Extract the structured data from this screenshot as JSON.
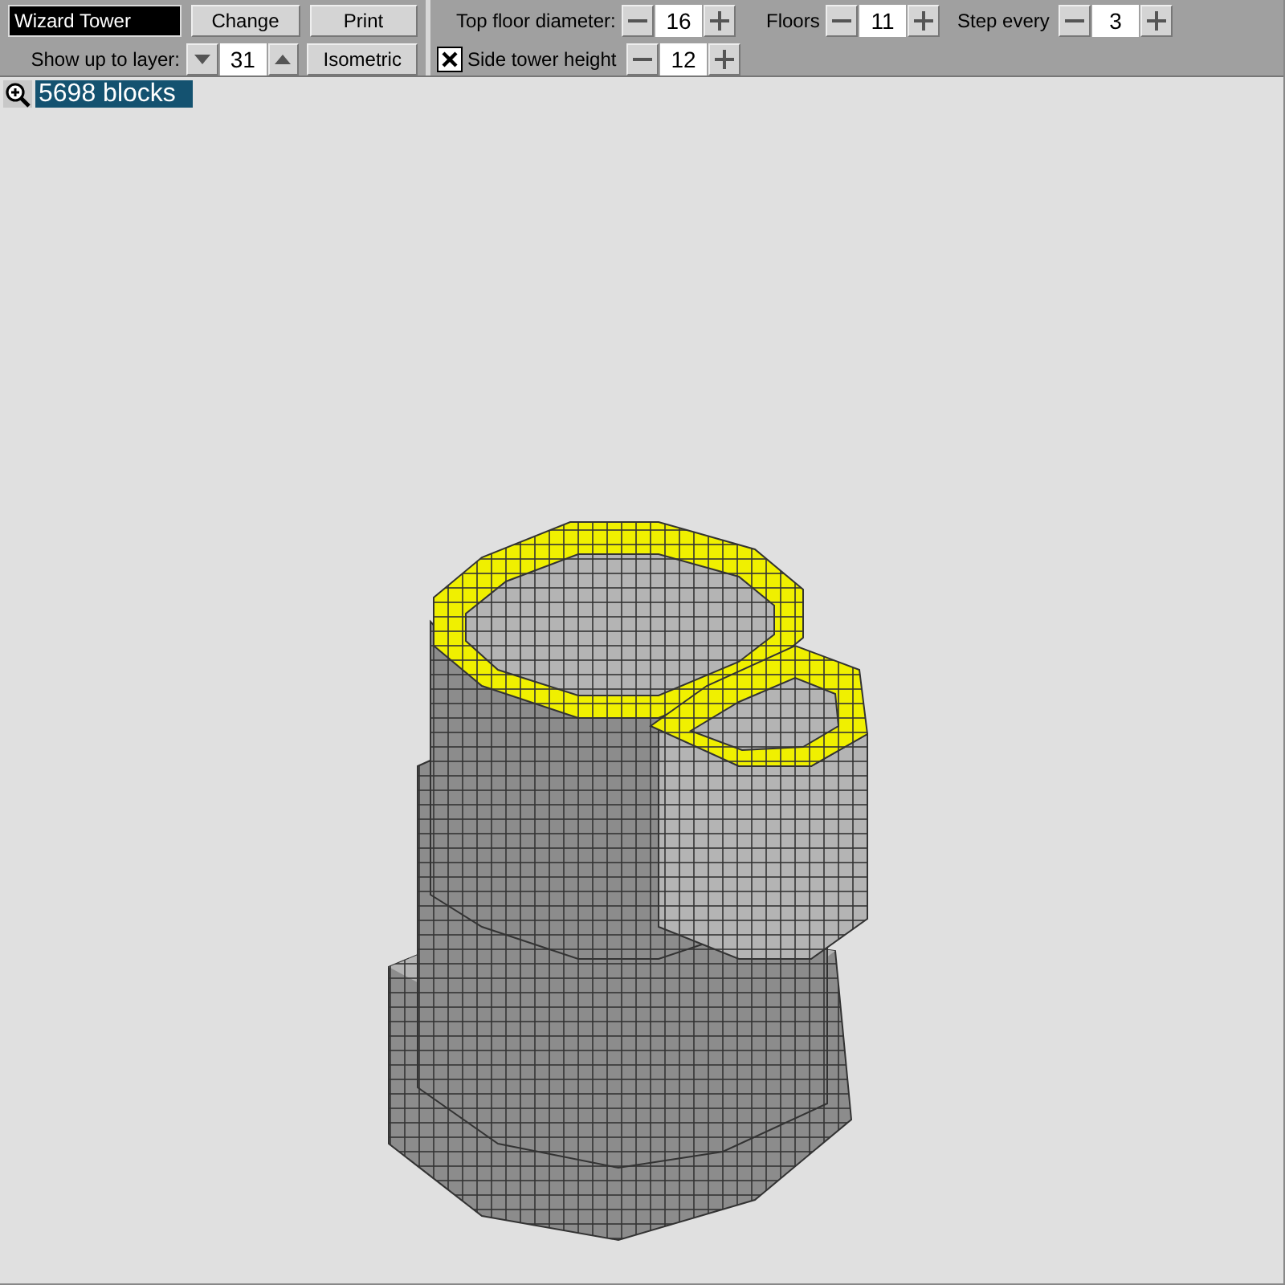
{
  "name_field": {
    "value": "Wizard Tower"
  },
  "buttons": [
    {
      "label": "Change"
    },
    {
      "label": "Print"
    },
    {
      "label": "Isometric"
    }
  ],
  "layer": {
    "label": "Show up to layer:",
    "value": "31"
  },
  "top_floor_diameter": {
    "label": "Top floor diameter:",
    "value": "16"
  },
  "floors": {
    "label": "Floors",
    "value": "11"
  },
  "step_every": {
    "label": "Step every",
    "value": "3"
  },
  "side_tower": {
    "label": "Side tower height",
    "checked": true,
    "value": "12"
  },
  "block_count": "5698 blocks"
}
